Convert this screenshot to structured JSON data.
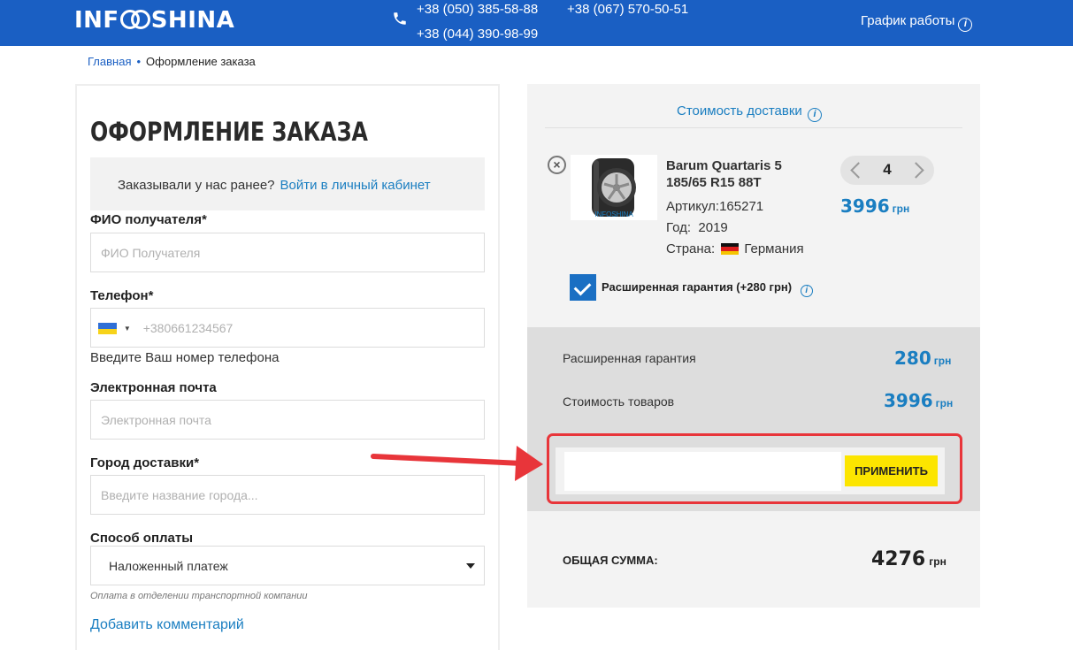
{
  "header": {
    "logo_pre": "INF",
    "logo_post": "SHINA",
    "phones": [
      "+38 (050) 385-58-88",
      "+38 (067) 570-50-51",
      "+38 (044) 390-98-99"
    ],
    "schedule": "График работы",
    "brand_color": "#1a5fc3"
  },
  "breadcrumb": {
    "home": "Главная",
    "current": "Оформление заказа"
  },
  "form": {
    "title": "ОФОРМЛЕНИЕ ЗАКАЗА",
    "login_prompt": "Заказывали у нас ранее?",
    "login_link": "Войти в личный кабинет",
    "name_label": "ФИО получателя*",
    "name_placeholder": "ФИО Получателя",
    "phone_label": "Телефон*",
    "phone_placeholder": "+380661234567",
    "phone_hint": "Введите Ваш номер телефона",
    "email_label": "Электронная почта",
    "email_placeholder": "Электронная почта",
    "city_label": "Город доставки*",
    "city_placeholder": "Введите название города...",
    "payment_label": "Способ оплаты",
    "payment_value": "Наложенный платеж",
    "payment_note": "Оплата в отделении транспортной компании",
    "add_comment": "Добавить комментарий"
  },
  "cart": {
    "delivery_cost": "Стоимость доставки",
    "product": {
      "name_line1": "Barum Quartaris 5",
      "name_line2": "185/65 R15 88T",
      "article": "Артикул:165271",
      "year_label": "Год:",
      "year": "2019",
      "country_label": "Страна:",
      "country": "Германия",
      "image_watermark": "INFOSHINA",
      "quantity": "4",
      "price": "3996",
      "currency": "грн"
    },
    "warranty_label": "Расширенная гарантия (+280 грн)",
    "warranty_checked": true
  },
  "summary": {
    "warranty_label": "Расширенная гарантия",
    "warranty_value": "280",
    "goods_label": "Стоимость товаров",
    "goods_value": "3996",
    "currency": "грн",
    "apply_button": "ПРИМЕНИТЬ",
    "total_label": "ОБЩАЯ СУММА:",
    "total_value": "4276"
  },
  "colors": {
    "accent": "#1a7ec1",
    "apply": "#fce500",
    "highlight": "#e8353a"
  }
}
